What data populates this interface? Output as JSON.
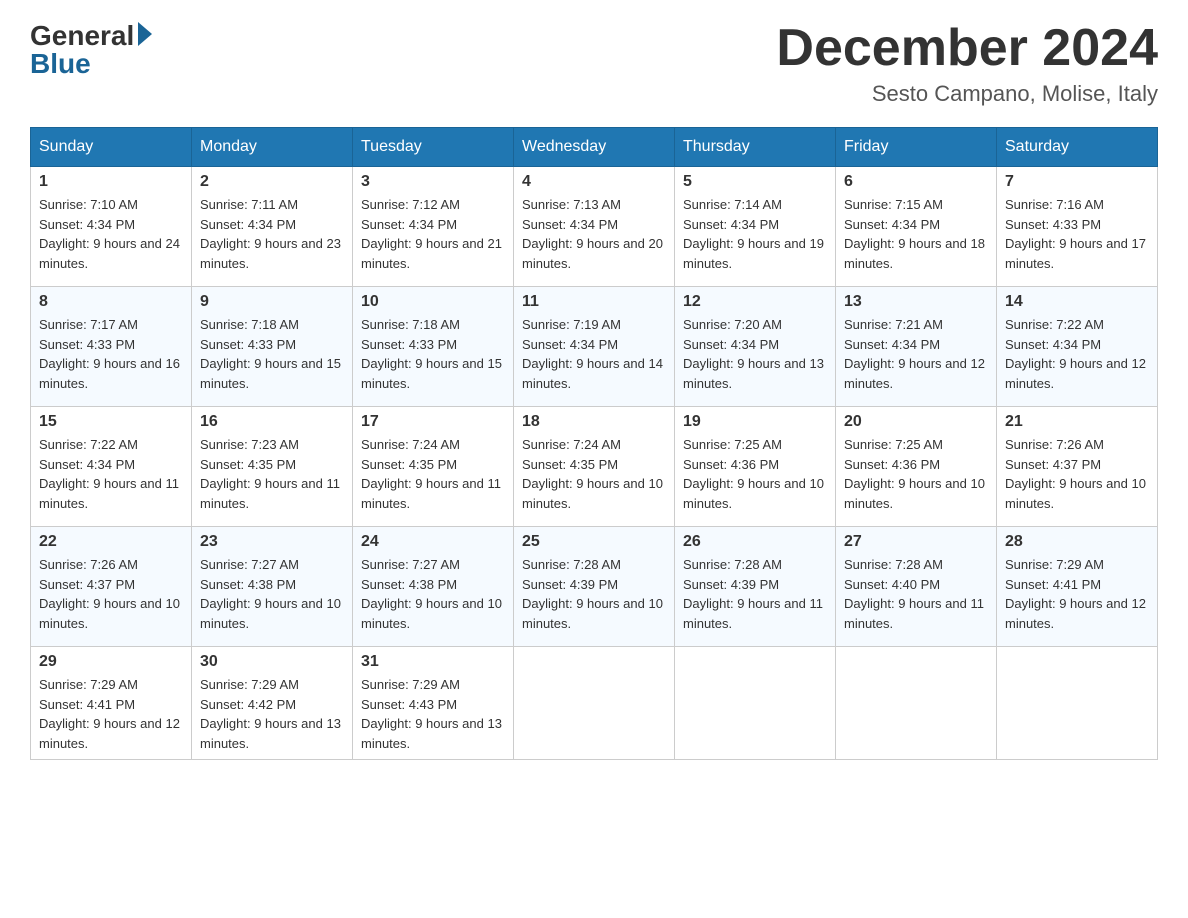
{
  "header": {
    "logo_general": "General",
    "logo_blue": "Blue",
    "month_title": "December 2024",
    "location": "Sesto Campano, Molise, Italy"
  },
  "days_of_week": [
    "Sunday",
    "Monday",
    "Tuesday",
    "Wednesday",
    "Thursday",
    "Friday",
    "Saturday"
  ],
  "weeks": [
    [
      {
        "day": "1",
        "sunrise": "7:10 AM",
        "sunset": "4:34 PM",
        "daylight": "9 hours and 24 minutes."
      },
      {
        "day": "2",
        "sunrise": "7:11 AM",
        "sunset": "4:34 PM",
        "daylight": "9 hours and 23 minutes."
      },
      {
        "day": "3",
        "sunrise": "7:12 AM",
        "sunset": "4:34 PM",
        "daylight": "9 hours and 21 minutes."
      },
      {
        "day": "4",
        "sunrise": "7:13 AM",
        "sunset": "4:34 PM",
        "daylight": "9 hours and 20 minutes."
      },
      {
        "day": "5",
        "sunrise": "7:14 AM",
        "sunset": "4:34 PM",
        "daylight": "9 hours and 19 minutes."
      },
      {
        "day": "6",
        "sunrise": "7:15 AM",
        "sunset": "4:34 PM",
        "daylight": "9 hours and 18 minutes."
      },
      {
        "day": "7",
        "sunrise": "7:16 AM",
        "sunset": "4:33 PM",
        "daylight": "9 hours and 17 minutes."
      }
    ],
    [
      {
        "day": "8",
        "sunrise": "7:17 AM",
        "sunset": "4:33 PM",
        "daylight": "9 hours and 16 minutes."
      },
      {
        "day": "9",
        "sunrise": "7:18 AM",
        "sunset": "4:33 PM",
        "daylight": "9 hours and 15 minutes."
      },
      {
        "day": "10",
        "sunrise": "7:18 AM",
        "sunset": "4:33 PM",
        "daylight": "9 hours and 15 minutes."
      },
      {
        "day": "11",
        "sunrise": "7:19 AM",
        "sunset": "4:34 PM",
        "daylight": "9 hours and 14 minutes."
      },
      {
        "day": "12",
        "sunrise": "7:20 AM",
        "sunset": "4:34 PM",
        "daylight": "9 hours and 13 minutes."
      },
      {
        "day": "13",
        "sunrise": "7:21 AM",
        "sunset": "4:34 PM",
        "daylight": "9 hours and 12 minutes."
      },
      {
        "day": "14",
        "sunrise": "7:22 AM",
        "sunset": "4:34 PM",
        "daylight": "9 hours and 12 minutes."
      }
    ],
    [
      {
        "day": "15",
        "sunrise": "7:22 AM",
        "sunset": "4:34 PM",
        "daylight": "9 hours and 11 minutes."
      },
      {
        "day": "16",
        "sunrise": "7:23 AM",
        "sunset": "4:35 PM",
        "daylight": "9 hours and 11 minutes."
      },
      {
        "day": "17",
        "sunrise": "7:24 AM",
        "sunset": "4:35 PM",
        "daylight": "9 hours and 11 minutes."
      },
      {
        "day": "18",
        "sunrise": "7:24 AM",
        "sunset": "4:35 PM",
        "daylight": "9 hours and 10 minutes."
      },
      {
        "day": "19",
        "sunrise": "7:25 AM",
        "sunset": "4:36 PM",
        "daylight": "9 hours and 10 minutes."
      },
      {
        "day": "20",
        "sunrise": "7:25 AM",
        "sunset": "4:36 PM",
        "daylight": "9 hours and 10 minutes."
      },
      {
        "day": "21",
        "sunrise": "7:26 AM",
        "sunset": "4:37 PM",
        "daylight": "9 hours and 10 minutes."
      }
    ],
    [
      {
        "day": "22",
        "sunrise": "7:26 AM",
        "sunset": "4:37 PM",
        "daylight": "9 hours and 10 minutes."
      },
      {
        "day": "23",
        "sunrise": "7:27 AM",
        "sunset": "4:38 PM",
        "daylight": "9 hours and 10 minutes."
      },
      {
        "day": "24",
        "sunrise": "7:27 AM",
        "sunset": "4:38 PM",
        "daylight": "9 hours and 10 minutes."
      },
      {
        "day": "25",
        "sunrise": "7:28 AM",
        "sunset": "4:39 PM",
        "daylight": "9 hours and 10 minutes."
      },
      {
        "day": "26",
        "sunrise": "7:28 AM",
        "sunset": "4:39 PM",
        "daylight": "9 hours and 11 minutes."
      },
      {
        "day": "27",
        "sunrise": "7:28 AM",
        "sunset": "4:40 PM",
        "daylight": "9 hours and 11 minutes."
      },
      {
        "day": "28",
        "sunrise": "7:29 AM",
        "sunset": "4:41 PM",
        "daylight": "9 hours and 12 minutes."
      }
    ],
    [
      {
        "day": "29",
        "sunrise": "7:29 AM",
        "sunset": "4:41 PM",
        "daylight": "9 hours and 12 minutes."
      },
      {
        "day": "30",
        "sunrise": "7:29 AM",
        "sunset": "4:42 PM",
        "daylight": "9 hours and 13 minutes."
      },
      {
        "day": "31",
        "sunrise": "7:29 AM",
        "sunset": "4:43 PM",
        "daylight": "9 hours and 13 minutes."
      },
      null,
      null,
      null,
      null
    ]
  ]
}
